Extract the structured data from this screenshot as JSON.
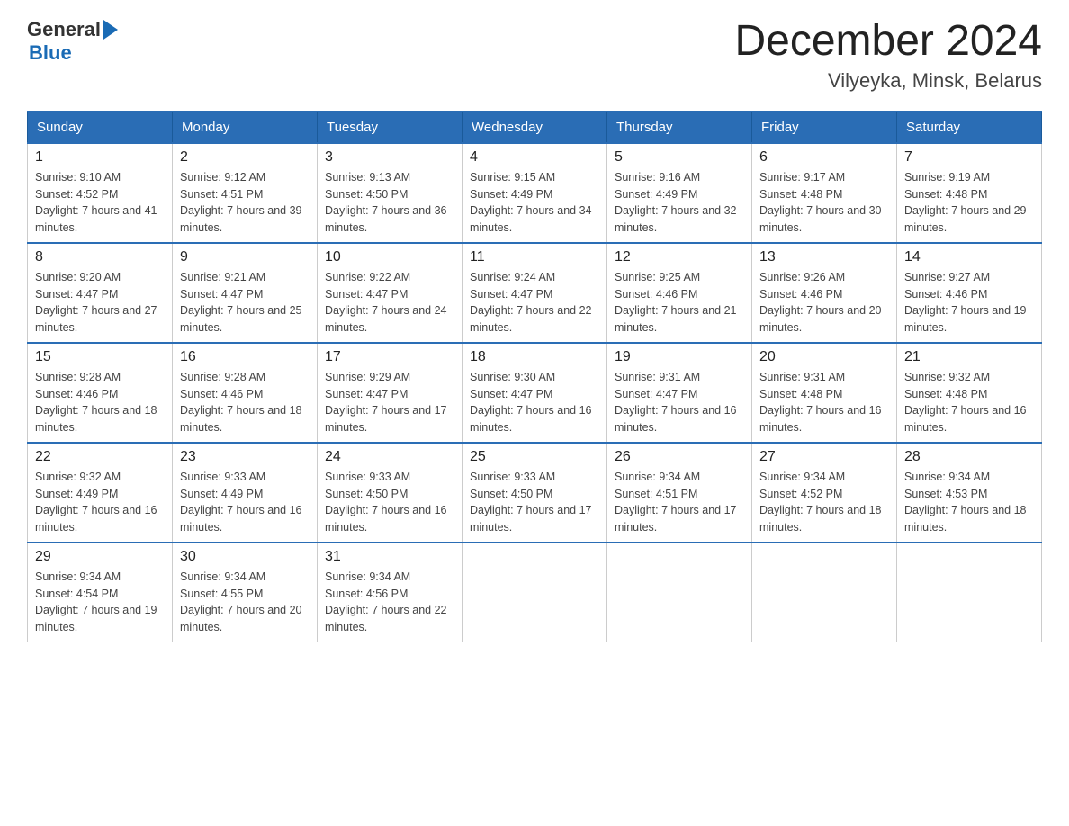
{
  "header": {
    "logo_general": "General",
    "logo_blue": "Blue",
    "month_title": "December 2024",
    "location": "Vilyeyka, Minsk, Belarus"
  },
  "days_of_week": [
    "Sunday",
    "Monday",
    "Tuesday",
    "Wednesday",
    "Thursday",
    "Friday",
    "Saturday"
  ],
  "weeks": [
    [
      {
        "day": "1",
        "sunrise": "Sunrise: 9:10 AM",
        "sunset": "Sunset: 4:52 PM",
        "daylight": "Daylight: 7 hours and 41 minutes."
      },
      {
        "day": "2",
        "sunrise": "Sunrise: 9:12 AM",
        "sunset": "Sunset: 4:51 PM",
        "daylight": "Daylight: 7 hours and 39 minutes."
      },
      {
        "day": "3",
        "sunrise": "Sunrise: 9:13 AM",
        "sunset": "Sunset: 4:50 PM",
        "daylight": "Daylight: 7 hours and 36 minutes."
      },
      {
        "day": "4",
        "sunrise": "Sunrise: 9:15 AM",
        "sunset": "Sunset: 4:49 PM",
        "daylight": "Daylight: 7 hours and 34 minutes."
      },
      {
        "day": "5",
        "sunrise": "Sunrise: 9:16 AM",
        "sunset": "Sunset: 4:49 PM",
        "daylight": "Daylight: 7 hours and 32 minutes."
      },
      {
        "day": "6",
        "sunrise": "Sunrise: 9:17 AM",
        "sunset": "Sunset: 4:48 PM",
        "daylight": "Daylight: 7 hours and 30 minutes."
      },
      {
        "day": "7",
        "sunrise": "Sunrise: 9:19 AM",
        "sunset": "Sunset: 4:48 PM",
        "daylight": "Daylight: 7 hours and 29 minutes."
      }
    ],
    [
      {
        "day": "8",
        "sunrise": "Sunrise: 9:20 AM",
        "sunset": "Sunset: 4:47 PM",
        "daylight": "Daylight: 7 hours and 27 minutes."
      },
      {
        "day": "9",
        "sunrise": "Sunrise: 9:21 AM",
        "sunset": "Sunset: 4:47 PM",
        "daylight": "Daylight: 7 hours and 25 minutes."
      },
      {
        "day": "10",
        "sunrise": "Sunrise: 9:22 AM",
        "sunset": "Sunset: 4:47 PM",
        "daylight": "Daylight: 7 hours and 24 minutes."
      },
      {
        "day": "11",
        "sunrise": "Sunrise: 9:24 AM",
        "sunset": "Sunset: 4:47 PM",
        "daylight": "Daylight: 7 hours and 22 minutes."
      },
      {
        "day": "12",
        "sunrise": "Sunrise: 9:25 AM",
        "sunset": "Sunset: 4:46 PM",
        "daylight": "Daylight: 7 hours and 21 minutes."
      },
      {
        "day": "13",
        "sunrise": "Sunrise: 9:26 AM",
        "sunset": "Sunset: 4:46 PM",
        "daylight": "Daylight: 7 hours and 20 minutes."
      },
      {
        "day": "14",
        "sunrise": "Sunrise: 9:27 AM",
        "sunset": "Sunset: 4:46 PM",
        "daylight": "Daylight: 7 hours and 19 minutes."
      }
    ],
    [
      {
        "day": "15",
        "sunrise": "Sunrise: 9:28 AM",
        "sunset": "Sunset: 4:46 PM",
        "daylight": "Daylight: 7 hours and 18 minutes."
      },
      {
        "day": "16",
        "sunrise": "Sunrise: 9:28 AM",
        "sunset": "Sunset: 4:46 PM",
        "daylight": "Daylight: 7 hours and 18 minutes."
      },
      {
        "day": "17",
        "sunrise": "Sunrise: 9:29 AM",
        "sunset": "Sunset: 4:47 PM",
        "daylight": "Daylight: 7 hours and 17 minutes."
      },
      {
        "day": "18",
        "sunrise": "Sunrise: 9:30 AM",
        "sunset": "Sunset: 4:47 PM",
        "daylight": "Daylight: 7 hours and 16 minutes."
      },
      {
        "day": "19",
        "sunrise": "Sunrise: 9:31 AM",
        "sunset": "Sunset: 4:47 PM",
        "daylight": "Daylight: 7 hours and 16 minutes."
      },
      {
        "day": "20",
        "sunrise": "Sunrise: 9:31 AM",
        "sunset": "Sunset: 4:48 PM",
        "daylight": "Daylight: 7 hours and 16 minutes."
      },
      {
        "day": "21",
        "sunrise": "Sunrise: 9:32 AM",
        "sunset": "Sunset: 4:48 PM",
        "daylight": "Daylight: 7 hours and 16 minutes."
      }
    ],
    [
      {
        "day": "22",
        "sunrise": "Sunrise: 9:32 AM",
        "sunset": "Sunset: 4:49 PM",
        "daylight": "Daylight: 7 hours and 16 minutes."
      },
      {
        "day": "23",
        "sunrise": "Sunrise: 9:33 AM",
        "sunset": "Sunset: 4:49 PM",
        "daylight": "Daylight: 7 hours and 16 minutes."
      },
      {
        "day": "24",
        "sunrise": "Sunrise: 9:33 AM",
        "sunset": "Sunset: 4:50 PM",
        "daylight": "Daylight: 7 hours and 16 minutes."
      },
      {
        "day": "25",
        "sunrise": "Sunrise: 9:33 AM",
        "sunset": "Sunset: 4:50 PM",
        "daylight": "Daylight: 7 hours and 17 minutes."
      },
      {
        "day": "26",
        "sunrise": "Sunrise: 9:34 AM",
        "sunset": "Sunset: 4:51 PM",
        "daylight": "Daylight: 7 hours and 17 minutes."
      },
      {
        "day": "27",
        "sunrise": "Sunrise: 9:34 AM",
        "sunset": "Sunset: 4:52 PM",
        "daylight": "Daylight: 7 hours and 18 minutes."
      },
      {
        "day": "28",
        "sunrise": "Sunrise: 9:34 AM",
        "sunset": "Sunset: 4:53 PM",
        "daylight": "Daylight: 7 hours and 18 minutes."
      }
    ],
    [
      {
        "day": "29",
        "sunrise": "Sunrise: 9:34 AM",
        "sunset": "Sunset: 4:54 PM",
        "daylight": "Daylight: 7 hours and 19 minutes."
      },
      {
        "day": "30",
        "sunrise": "Sunrise: 9:34 AM",
        "sunset": "Sunset: 4:55 PM",
        "daylight": "Daylight: 7 hours and 20 minutes."
      },
      {
        "day": "31",
        "sunrise": "Sunrise: 9:34 AM",
        "sunset": "Sunset: 4:56 PM",
        "daylight": "Daylight: 7 hours and 22 minutes."
      },
      null,
      null,
      null,
      null
    ]
  ]
}
